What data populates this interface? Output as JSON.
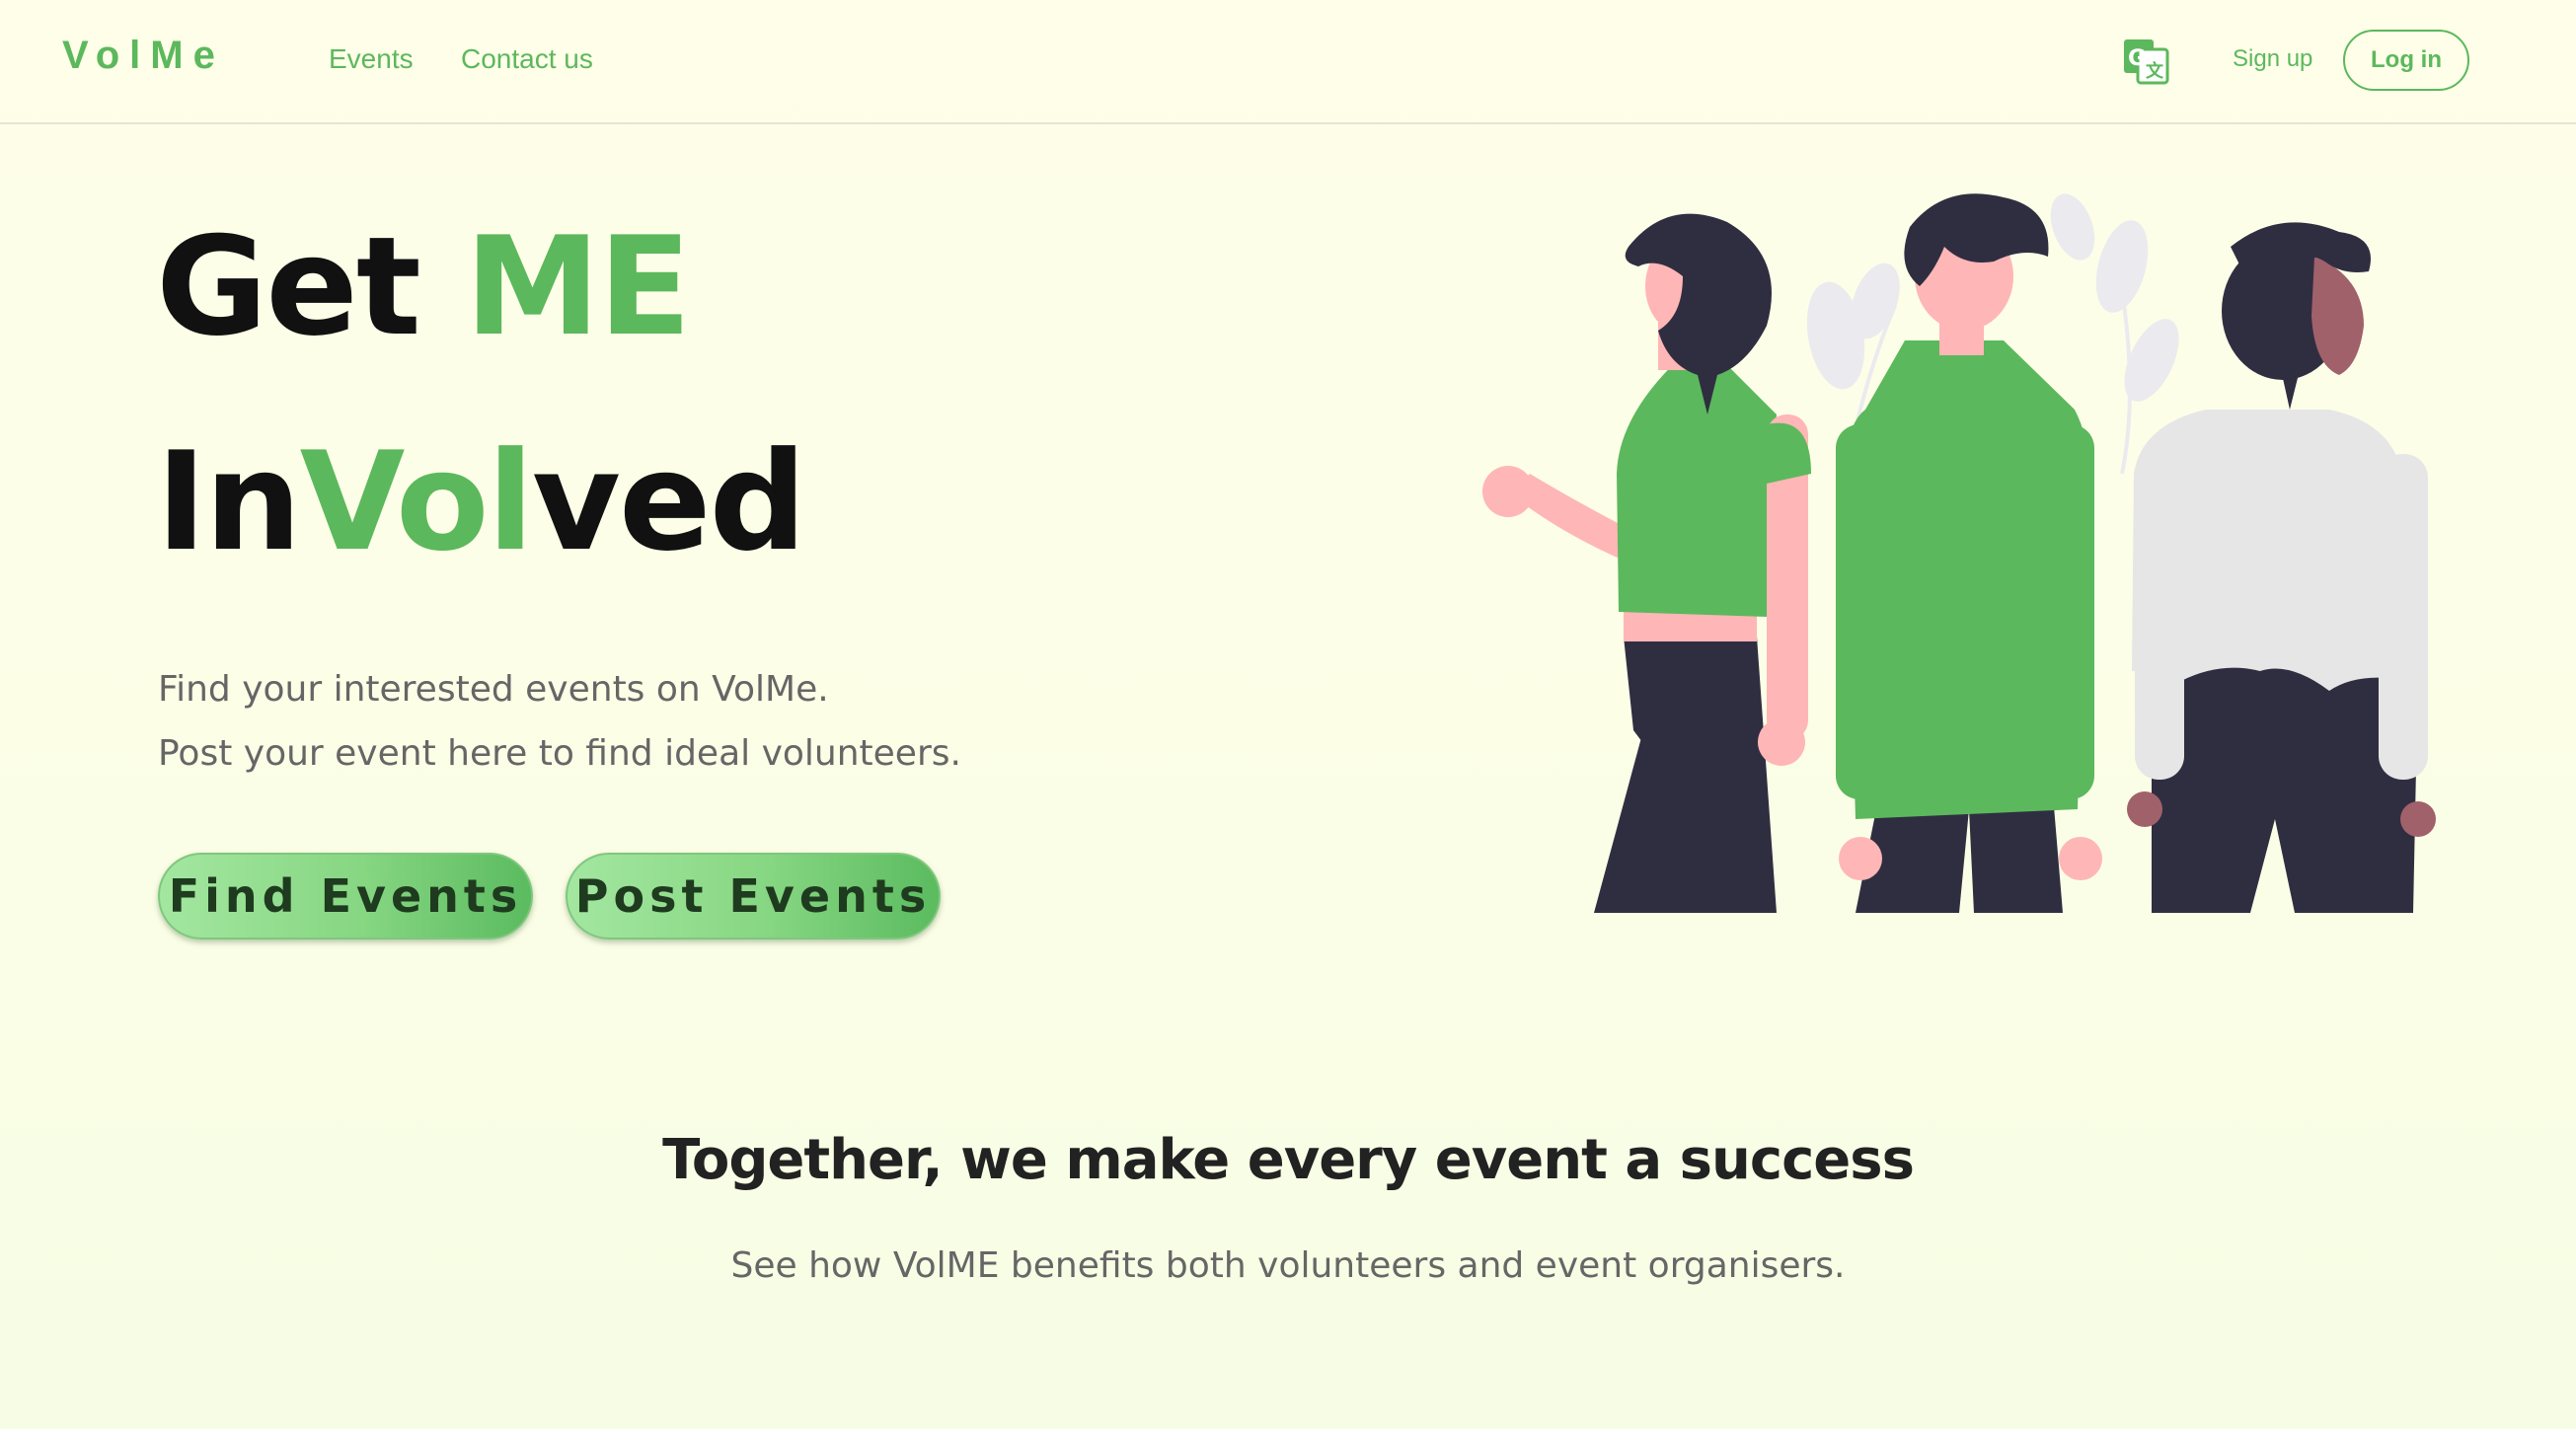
{
  "nav": {
    "logo": "VolMe",
    "links": [
      "Events",
      "Contact us"
    ],
    "translate_icon": "google-translate-icon",
    "signup_label": "Sign up",
    "login_label": "Log in"
  },
  "hero": {
    "line1_black": "Get ",
    "line1_green": "ME",
    "line2_black_a": "In",
    "line2_green": "Vol",
    "line2_black_b": "ved",
    "subtitle_1": "Find your interested events on VolMe.",
    "subtitle_2": "Post your event here to find ideal volunteers.",
    "find_button": "Find Events",
    "post_button": "Post Events",
    "illustration": "three-people-illustration"
  },
  "section": {
    "title": "Together, we make every event a success",
    "subtitle": "See how VolME benefits both volunteers and event organisers."
  },
  "colors": {
    "accent": "#5cb85c",
    "dark": "#2f2e41",
    "skin": "#ffb6b6",
    "shirt_white": "#e6e6e6"
  }
}
